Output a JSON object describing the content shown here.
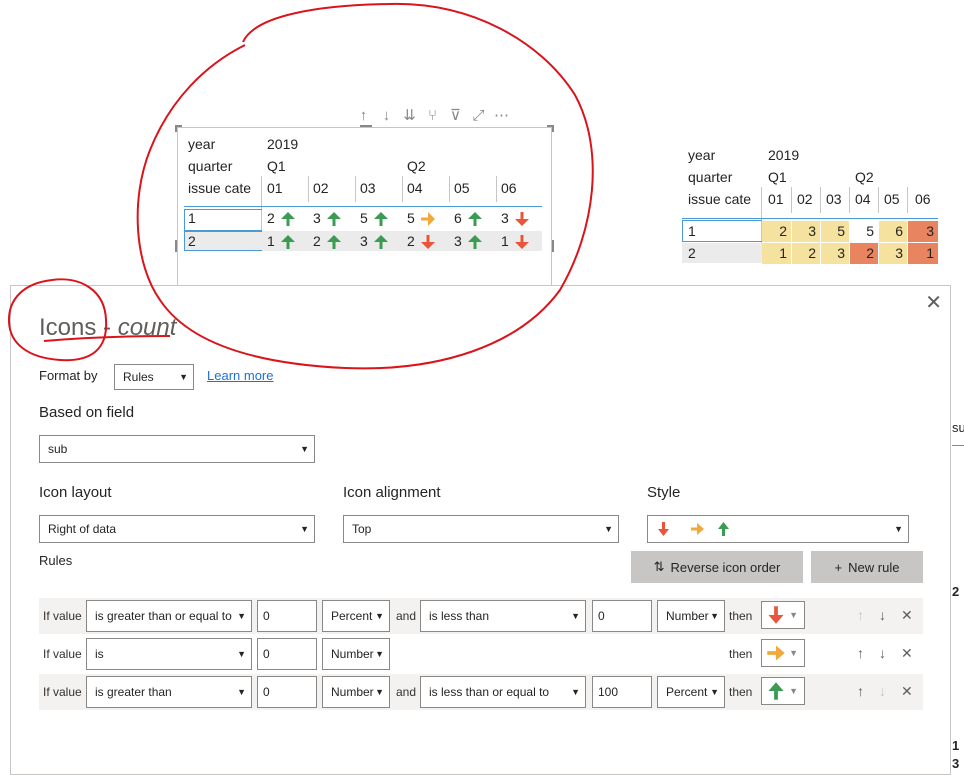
{
  "visual_toolbar": {
    "icons": [
      "drill-up-icon",
      "drill-down-icon",
      "expand-next-level-icon",
      "expand-hierarchy-icon",
      "filter-icon",
      "focus-mode-icon",
      "more-options-icon"
    ]
  },
  "matrix_icons": {
    "row_headers": {
      "year": "year",
      "quarter": "quarter",
      "issue": "issue cate"
    },
    "year_value": "2019",
    "quarters": [
      "Q1",
      "Q2"
    ],
    "months": [
      "01",
      "02",
      "03",
      "04",
      "05",
      "06"
    ],
    "rows": [
      {
        "label": "1",
        "values": [
          "2",
          "3",
          "5",
          "5",
          "6",
          "3"
        ],
        "icons": [
          "up",
          "up",
          "up",
          "right",
          "up",
          "down"
        ]
      },
      {
        "label": "2",
        "values": [
          "1",
          "2",
          "3",
          "2",
          "3",
          "1"
        ],
        "icons": [
          "up",
          "up",
          "up",
          "down",
          "up",
          "down"
        ]
      }
    ]
  },
  "matrix_colors": {
    "row_headers": {
      "year": "year",
      "quarter": "quarter",
      "issue": "issue cate"
    },
    "year_value": "2019",
    "quarters": [
      "Q1",
      "Q2"
    ],
    "months": [
      "01",
      "02",
      "03",
      "04",
      "05",
      "06"
    ],
    "rows": [
      {
        "label": "1",
        "values": [
          "2",
          "3",
          "5",
          "5",
          "6",
          "3"
        ],
        "fills": [
          "#f5e29e",
          "#f5e29e",
          "#f5e29e",
          "#ffffff",
          "#f5e29e",
          "#e8845f"
        ]
      },
      {
        "label": "2",
        "values": [
          "1",
          "2",
          "3",
          "2",
          "3",
          "1"
        ],
        "fills": [
          "#f5e29e",
          "#f5e29e",
          "#f5e29e",
          "#e8845f",
          "#f5e29e",
          "#e8845f"
        ]
      }
    ]
  },
  "dialog": {
    "title_prefix": "Icons - ",
    "title_field": "count",
    "close_icon": "close-icon",
    "format_by_label": "Format by",
    "format_by_value": "Rules",
    "learn_more": "Learn more",
    "based_on_label": "Based on field",
    "based_on_value": "sub",
    "icon_layout_label": "Icon layout",
    "icon_layout_value": "Right of data",
    "icon_alignment_label": "Icon alignment",
    "icon_alignment_value": "Top",
    "style_label": "Style",
    "rules_label": "Rules",
    "reverse_btn": "Reverse icon order",
    "new_rule_btn": "New rule",
    "rules": [
      {
        "if": "If value",
        "cond1": "is greater than or equal to",
        "val1": "0",
        "type1": "Percent",
        "and": "and",
        "cond2": "is less than",
        "val2": "0",
        "type2": "Number",
        "then": "then",
        "icon": "down"
      },
      {
        "if": "If value",
        "cond1": "is",
        "val1": "0",
        "type1": "Number",
        "then": "then",
        "icon": "right"
      },
      {
        "if": "If value",
        "cond1": "is greater than",
        "val1": "0",
        "type1": "Number",
        "and": "and",
        "cond2": "is less than or equal to",
        "val2": "100",
        "type2": "Percent",
        "then": "then",
        "icon": "up"
      }
    ]
  },
  "background_sliver": [
    "su",
    "2",
    "1",
    "3"
  ],
  "colors": {
    "up": "#3a9b52",
    "right": "#f2a93b",
    "down": "#e8553b",
    "annotation": "#d9141b",
    "accent": "#4a9ad8"
  }
}
